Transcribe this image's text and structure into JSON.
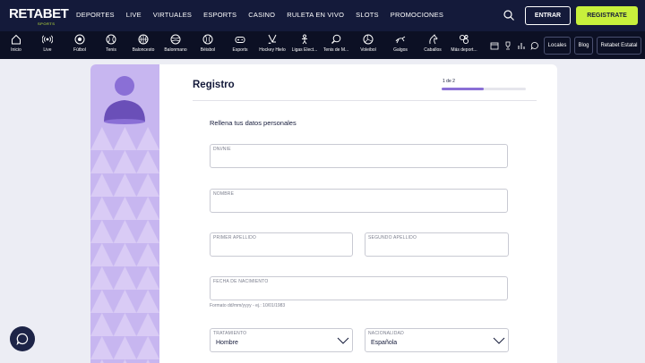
{
  "brand": {
    "name_a": "RETA",
    "name_b": "BET",
    "sub": "SPORTS"
  },
  "topnav": [
    "DEPORTES",
    "LIVE",
    "VIRTUALES",
    "ESPORTS",
    "CASINO",
    "RULETA EN VIVO",
    "SLOTS",
    "PROMOCIONES"
  ],
  "auth": {
    "login": "ENTRAR",
    "register": "REGISTRATE"
  },
  "sports": [
    {
      "label": "Inicio",
      "icon": "home-icon"
    },
    {
      "label": "Live",
      "icon": "live-icon"
    },
    {
      "label": "Fútbol",
      "icon": "football-icon"
    },
    {
      "label": "Tenis",
      "icon": "tennis-icon"
    },
    {
      "label": "Baloncesto",
      "icon": "basketball-icon"
    },
    {
      "label": "Balonmano",
      "icon": "handball-icon"
    },
    {
      "label": "Béisbol",
      "icon": "baseball-icon"
    },
    {
      "label": "Esports",
      "icon": "esports-icon"
    },
    {
      "label": "Hockey Hielo",
      "icon": "ice-hockey-icon"
    },
    {
      "label": "Ligas Elect...",
      "icon": "esoccer-icon"
    },
    {
      "label": "Tenis de M...",
      "icon": "table-tennis-icon"
    },
    {
      "label": "Voleibol",
      "icon": "volleyball-icon"
    },
    {
      "label": "Galgos",
      "icon": "greyhound-icon"
    },
    {
      "label": "Caballos",
      "icon": "horse-icon"
    },
    {
      "label": "Más deport...",
      "icon": "more-sports-icon"
    }
  ],
  "links": {
    "locales": "Locales",
    "blog": "Blog",
    "estatal": "Retabet Estatal"
  },
  "form": {
    "title": "Registro",
    "step": "1 de 2",
    "progress": 0.5,
    "subtitle": "Rellena tus datos personales",
    "fields": {
      "dni": "DNI/NIE",
      "nombre": "NOMBRE",
      "apellido1": "PRIMER APELLIDO",
      "apellido2": "SEGUNDO APELLIDO",
      "nacimiento": "FECHA DE NACIMIENTO",
      "tratamiento": "TRATAMIENTO",
      "tratamiento_value": "Hombre",
      "nacionalidad": "NACIONALIDAD",
      "nacionalidad_value": "Española"
    },
    "date_hint": "Formato dd/mm/yyyy - ej.: 10/01/1983"
  },
  "colors": {
    "nav": "#141a3a",
    "accent": "#c8f03c",
    "purple": "#8a6fd6"
  }
}
